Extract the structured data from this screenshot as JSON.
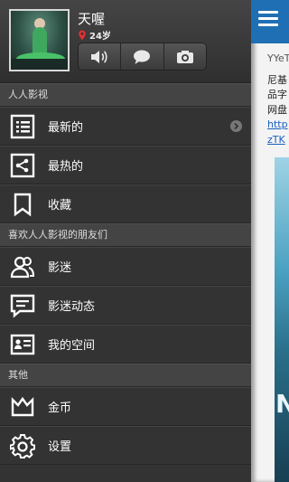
{
  "profile": {
    "username": "天喔",
    "age": "24岁"
  },
  "sections": {
    "renren": "人人影视",
    "friends": "喜欢人人影视的朋友们",
    "other": "其他"
  },
  "menu": {
    "latest": "最新的",
    "hottest": "最热的",
    "favorites": "收藏",
    "fans": "影迷",
    "fan_feed": "影迷动态",
    "my_space": "我的空间",
    "coins": "金币",
    "settings": "设置"
  },
  "content": {
    "line1": "YYeT",
    "line2": "尼基",
    "line3": "品字",
    "line4": "网盘",
    "link1": "http",
    "link2": "zTK",
    "image_text": "N"
  },
  "colors": {
    "accent_bar": "#1f6fb4",
    "drawer_bg": "#333333",
    "section_bg": "#444444",
    "pin": "#e03030"
  }
}
